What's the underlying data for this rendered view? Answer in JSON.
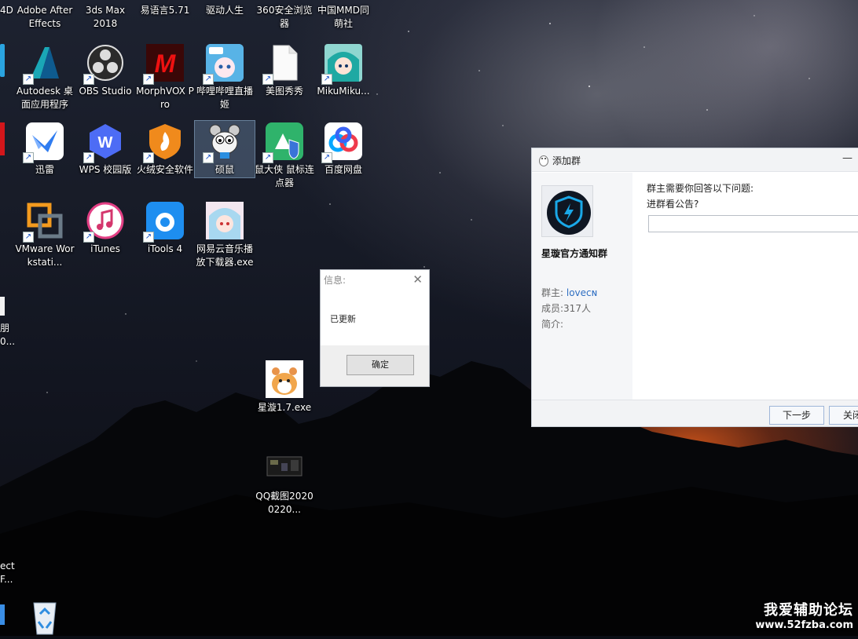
{
  "desktop": {
    "top_row_labels": [
      "Adobe After Effects",
      "3ds Max 2018",
      "易语言5.71",
      "驱动人生",
      "360安全浏览器",
      "中国MMD同萌社"
    ],
    "edge_labels": {
      "top_left": "4D",
      "middle_left_1": "朋",
      "middle_left_2": "0...",
      "bottom_left_1": "ect",
      "bottom_left_2": "F..."
    },
    "icons": {
      "autodesk": "Autodesk 桌面应用程序",
      "obs": "OBS Studio",
      "morphvox": "MorphVOX Pro",
      "bilibili": "哔哩哔哩直播姬",
      "meitu": "美图秀秀",
      "mikumiku": "MikuMiku...",
      "xunlei": "迅雷",
      "wps": "WPS 校园版",
      "huorong": "火绒安全软件",
      "shuoshu": "硕鼠",
      "shubiao": "鼠大侠 鼠标连点器",
      "baidu": "百度网盘",
      "vmware": "VMware Workstati...",
      "itunes": "iTunes",
      "itools": "iTools 4",
      "netease": "网易云音乐播放下载器.exe",
      "xingxuan": "星漩1.7.exe",
      "qqshot": "QQ截图20200220..."
    }
  },
  "msgbox": {
    "title": "信息:",
    "close": "✕",
    "message": "已更新",
    "ok_label": "确定"
  },
  "qq_window": {
    "title": "添加群",
    "minimize": "—",
    "group_name": "星璇官方通知群",
    "owner_label": "群主:",
    "owner_value": "loveᴄɴ",
    "members_label": "成员:",
    "members_value": "317人",
    "intro_label": "简介:",
    "question_header": "群主需要你回答以下问题:",
    "question": "进群看公告?",
    "answer_value": "",
    "next_label": "下一步",
    "close_label": "关闭"
  },
  "watermark": {
    "line1": "我爱辅助论坛",
    "line2": "www.52fzba.com"
  },
  "colors": {
    "link": "#2f6fc2",
    "sunset": "#e25a19"
  }
}
